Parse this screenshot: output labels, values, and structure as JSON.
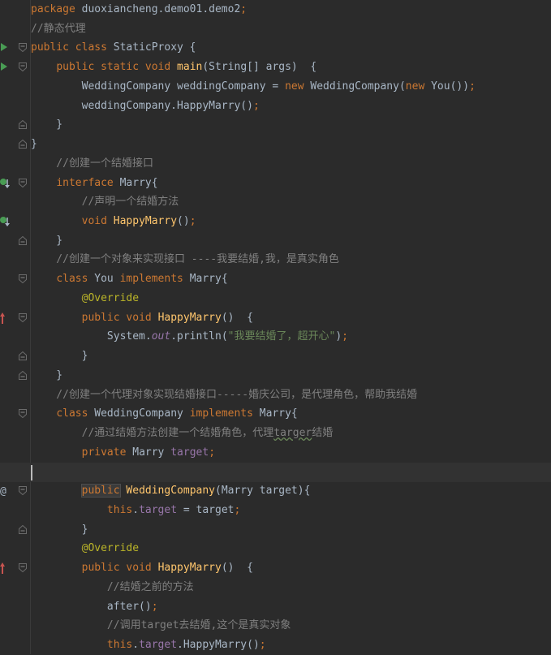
{
  "editor": {
    "colors": {
      "background": "#2b2b2b",
      "keyword": "#cc7832",
      "comment": "#808080",
      "method": "#ffc66d",
      "annotation": "#bbb529",
      "string": "#6a8759",
      "field": "#9876aa",
      "text": "#a9b7c6"
    },
    "lines": [
      [
        {
          "t": "package",
          "c": "kw"
        },
        {
          "t": " duoxiancheng.demo01.demo2",
          "c": ""
        },
        {
          "t": ";",
          "c": "kw"
        }
      ],
      [
        {
          "t": "//静态代理",
          "c": "cm"
        }
      ],
      [
        {
          "t": "public",
          "c": "kw"
        },
        {
          "t": " ",
          "c": ""
        },
        {
          "t": "class",
          "c": "kw"
        },
        {
          "t": " StaticProxy {",
          "c": ""
        }
      ],
      [
        {
          "t": "    ",
          "c": ""
        },
        {
          "t": "public",
          "c": "kw"
        },
        {
          "t": " ",
          "c": ""
        },
        {
          "t": "static",
          "c": "kw"
        },
        {
          "t": " ",
          "c": ""
        },
        {
          "t": "void",
          "c": "kw"
        },
        {
          "t": " ",
          "c": ""
        },
        {
          "t": "main",
          "c": "fn"
        },
        {
          "t": "(String[] args)  {",
          "c": ""
        }
      ],
      [
        {
          "t": "        WeddingCompany weddingCompany = ",
          "c": ""
        },
        {
          "t": "new",
          "c": "kw"
        },
        {
          "t": " WeddingCompany(",
          "c": ""
        },
        {
          "t": "new",
          "c": "kw"
        },
        {
          "t": " You())",
          "c": ""
        },
        {
          "t": ";",
          "c": "kw"
        }
      ],
      [
        {
          "t": "        weddingCompany.HappyMarry()",
          "c": ""
        },
        {
          "t": ";",
          "c": "kw"
        }
      ],
      [
        {
          "t": "    }",
          "c": ""
        }
      ],
      [
        {
          "t": "}",
          "c": ""
        }
      ],
      [
        {
          "t": "    //创建一个结婚接口",
          "c": "cm"
        }
      ],
      [
        {
          "t": "    ",
          "c": ""
        },
        {
          "t": "interface",
          "c": "kw"
        },
        {
          "t": " Marry{",
          "c": ""
        }
      ],
      [
        {
          "t": "        //声明一个结婚方法",
          "c": "cm"
        }
      ],
      [
        {
          "t": "        ",
          "c": ""
        },
        {
          "t": "void",
          "c": "kw"
        },
        {
          "t": " ",
          "c": ""
        },
        {
          "t": "HappyMarry",
          "c": "fn"
        },
        {
          "t": "()",
          "c": ""
        },
        {
          "t": ";",
          "c": "kw"
        }
      ],
      [
        {
          "t": "    }",
          "c": ""
        }
      ],
      [
        {
          "t": "    //创建一个对象来实现接口 ----我要结婚,我，是真实角色",
          "c": "cm"
        }
      ],
      [
        {
          "t": "    ",
          "c": ""
        },
        {
          "t": "class",
          "c": "kw"
        },
        {
          "t": " You ",
          "c": ""
        },
        {
          "t": "implements",
          "c": "kw"
        },
        {
          "t": " Marry{",
          "c": ""
        }
      ],
      [
        {
          "t": "        ",
          "c": ""
        },
        {
          "t": "@Override",
          "c": "an"
        }
      ],
      [
        {
          "t": "        ",
          "c": ""
        },
        {
          "t": "public",
          "c": "kw"
        },
        {
          "t": " ",
          "c": ""
        },
        {
          "t": "void",
          "c": "kw"
        },
        {
          "t": " ",
          "c": ""
        },
        {
          "t": "HappyMarry",
          "c": "fn"
        },
        {
          "t": "()  {",
          "c": ""
        }
      ],
      [
        {
          "t": "            System.",
          "c": ""
        },
        {
          "t": "out",
          "c": "fd it"
        },
        {
          "t": ".println(",
          "c": ""
        },
        {
          "t": "\"我要结婚了，超开心\"",
          "c": "st"
        },
        {
          "t": ")",
          "c": ""
        },
        {
          "t": ";",
          "c": "kw"
        }
      ],
      [
        {
          "t": "        }",
          "c": ""
        }
      ],
      [
        {
          "t": "    }",
          "c": ""
        }
      ],
      [
        {
          "t": "    //创建一个代理对象实现结婚接口-----婚庆公司，是代理角色，帮助我结婚",
          "c": "cm"
        }
      ],
      [
        {
          "t": "    ",
          "c": ""
        },
        {
          "t": "class",
          "c": "kw"
        },
        {
          "t": " WeddingCompany ",
          "c": ""
        },
        {
          "t": "implements",
          "c": "kw"
        },
        {
          "t": " Marry{",
          "c": ""
        }
      ],
      [
        {
          "t": "        //通过结婚方法创建一个结婚角色，代理",
          "c": "cm"
        },
        {
          "t": "targer",
          "c": "cm typo"
        },
        {
          "t": "结婚",
          "c": "cm"
        }
      ],
      [
        {
          "t": "        ",
          "c": ""
        },
        {
          "t": "private",
          "c": "kw"
        },
        {
          "t": " Marry ",
          "c": ""
        },
        {
          "t": "target",
          "c": "fd"
        },
        {
          "t": ";",
          "c": "kw"
        }
      ],
      [],
      [
        {
          "t": "        ",
          "c": ""
        },
        {
          "t": "public",
          "c": "kw hl"
        },
        {
          "t": " ",
          "c": ""
        },
        {
          "t": "WeddingCompany",
          "c": "fn"
        },
        {
          "t": "(Marry target){",
          "c": ""
        }
      ],
      [
        {
          "t": "            ",
          "c": ""
        },
        {
          "t": "this",
          "c": "kw"
        },
        {
          "t": ".",
          "c": ""
        },
        {
          "t": "target",
          "c": "fd"
        },
        {
          "t": " = target",
          "c": ""
        },
        {
          "t": ";",
          "c": "kw"
        }
      ],
      [
        {
          "t": "        }",
          "c": ""
        }
      ],
      [
        {
          "t": "        ",
          "c": ""
        },
        {
          "t": "@Override",
          "c": "an"
        }
      ],
      [
        {
          "t": "        ",
          "c": ""
        },
        {
          "t": "public",
          "c": "kw"
        },
        {
          "t": " ",
          "c": ""
        },
        {
          "t": "void",
          "c": "kw"
        },
        {
          "t": " ",
          "c": ""
        },
        {
          "t": "HappyMarry",
          "c": "fn"
        },
        {
          "t": "()  {",
          "c": ""
        }
      ],
      [
        {
          "t": "            //结婚之前的方法",
          "c": "cm"
        }
      ],
      [
        {
          "t": "            after()",
          "c": ""
        },
        {
          "t": ";",
          "c": "kw"
        }
      ],
      [
        {
          "t": "            //调用target去结婚,这个是真实对象",
          "c": "cm"
        }
      ],
      [
        {
          "t": "            ",
          "c": ""
        },
        {
          "t": "this",
          "c": "kw"
        },
        {
          "t": ".",
          "c": ""
        },
        {
          "t": "target",
          "c": "fd"
        },
        {
          "t": ".HappyMarry()",
          "c": ""
        },
        {
          "t": ";",
          "c": "kw"
        }
      ]
    ],
    "current_line": 24,
    "gutter": {
      "run_markers": [
        2,
        3
      ],
      "implemented_markers": [
        9,
        11
      ],
      "override_markers": [
        16,
        29
      ],
      "at_markers": [
        25
      ],
      "fold_open": [
        2,
        3,
        9,
        14,
        16,
        21,
        25,
        29
      ],
      "fold_close": [
        6,
        7,
        12,
        18,
        19,
        27
      ]
    }
  }
}
